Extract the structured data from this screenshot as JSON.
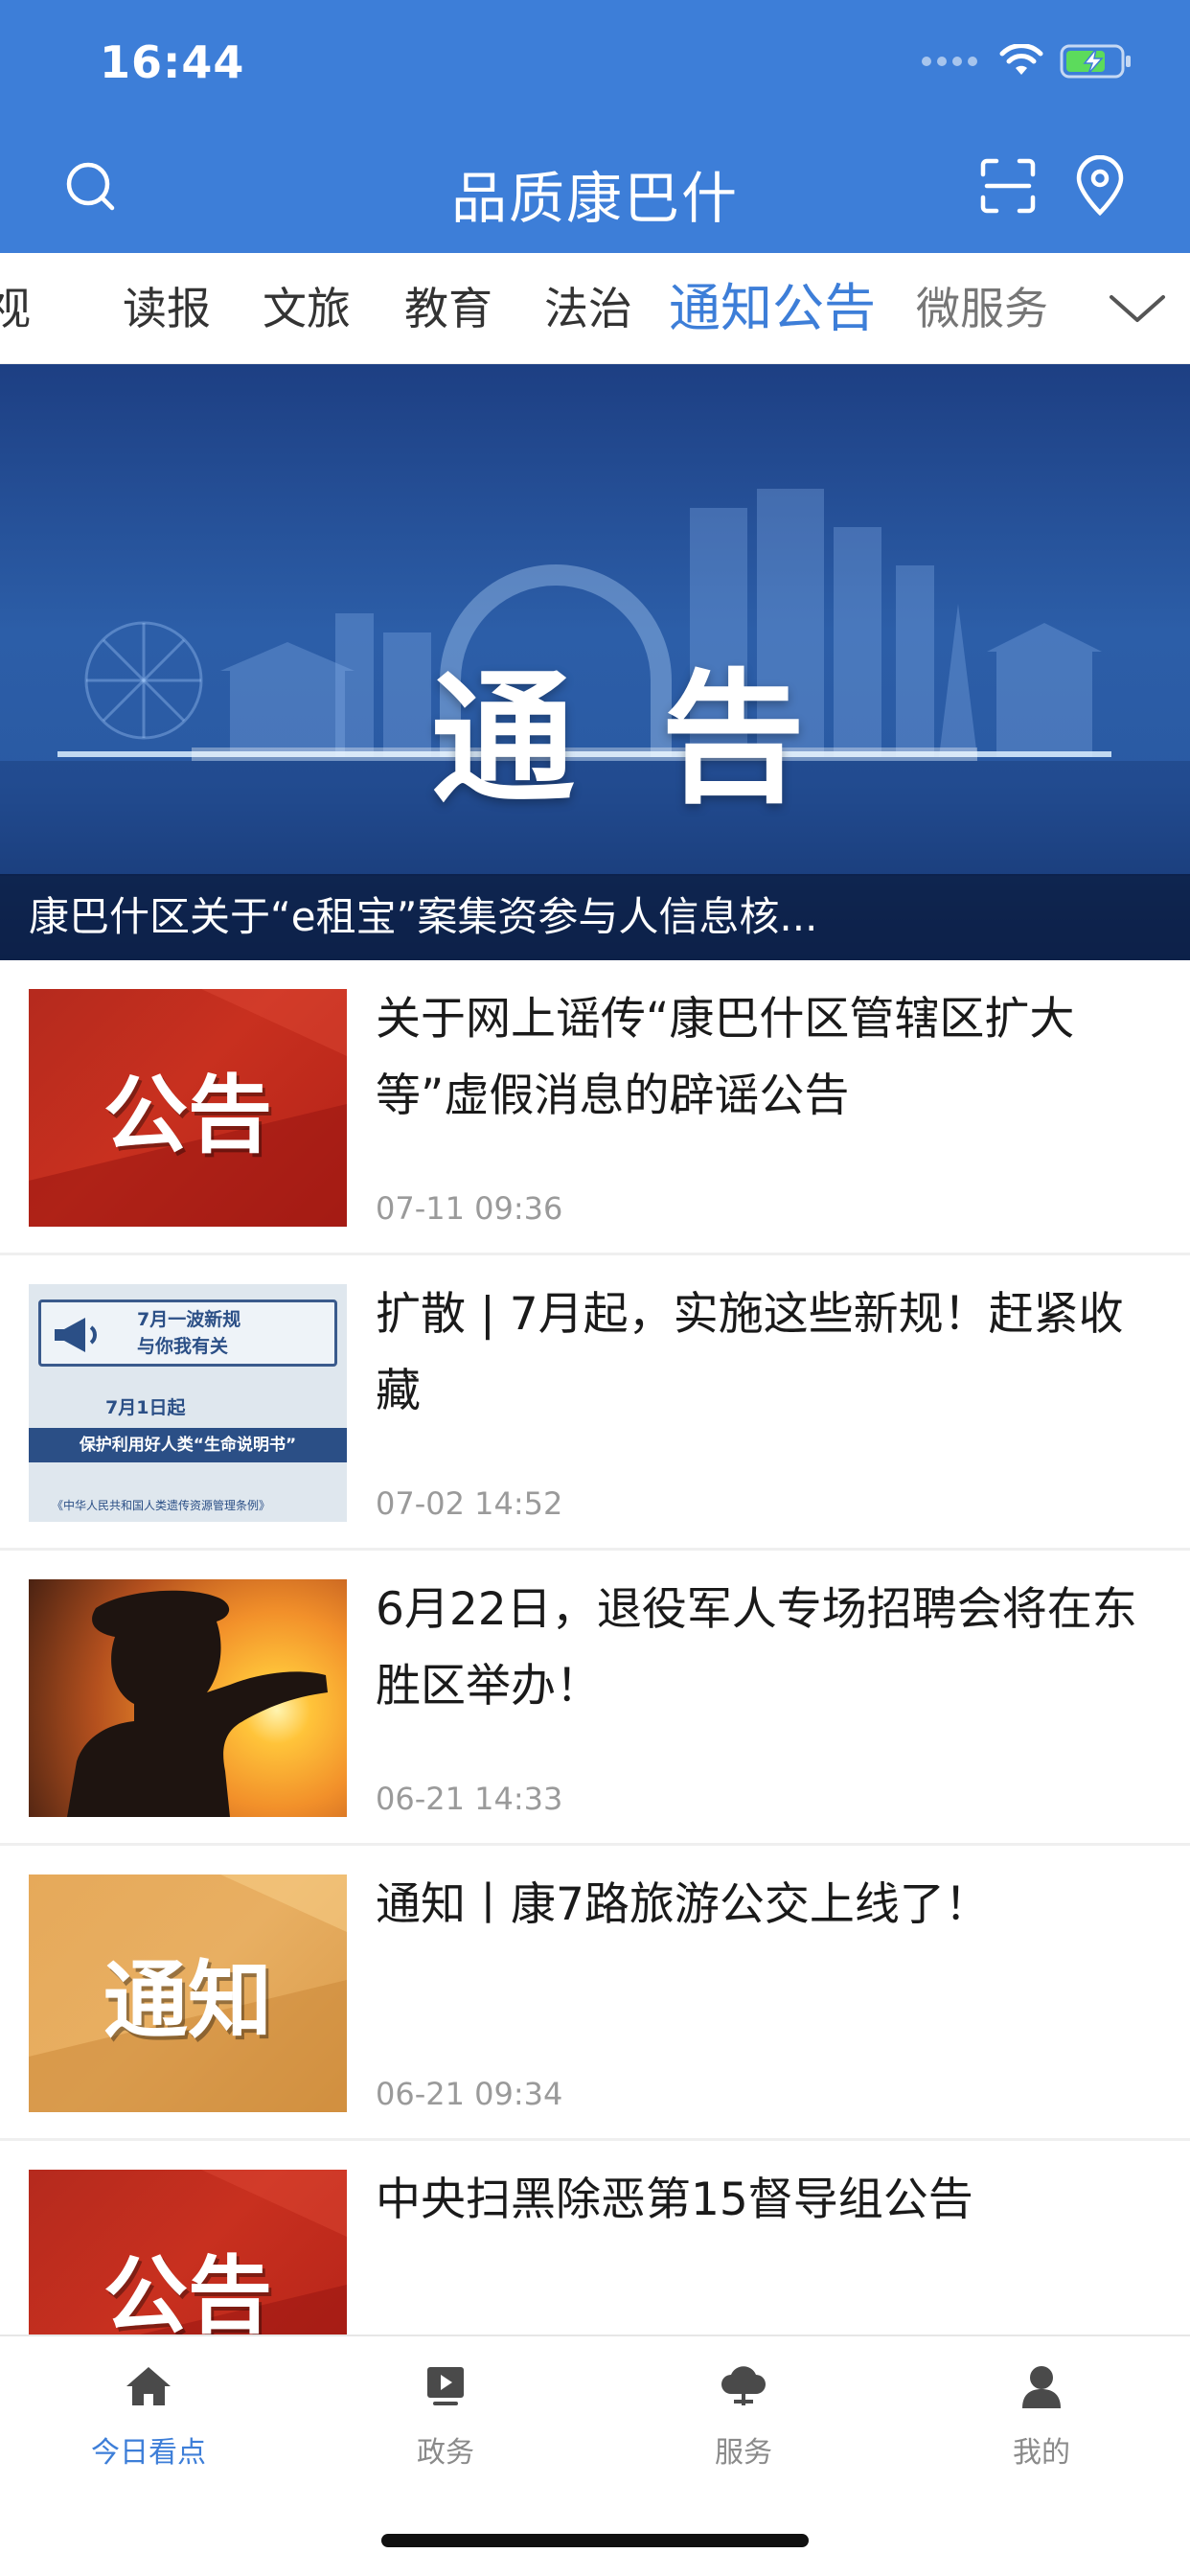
{
  "status_bar": {
    "time": "16:44"
  },
  "header": {
    "title": "品质康巴什",
    "icons": [
      "search-icon",
      "scan-icon",
      "location-pin-icon"
    ]
  },
  "tabs": {
    "items": [
      "视",
      "读报",
      "文旅",
      "教育",
      "法治",
      "通知公告",
      "微服务"
    ],
    "active": "通知公告",
    "more_icon": "chevron-down-icon"
  },
  "banner": {
    "image_text_left": "通",
    "image_text_right": "告",
    "caption": "康巴什区关于“e租宝”案集资参与人信息核..."
  },
  "news": [
    {
      "title": "关于网上谣传“康巴什区管辖区扩大等”虚假消息的辟谣公告",
      "time": "07-11 09:36",
      "thumb_text": "公告"
    },
    {
      "title": "扩散 | 7月起，实施这些新规！赶紧收藏",
      "time": "07-02 14:52",
      "thumb_lines": [
        "7月一波新规",
        "与你我有关",
        "7月1日起",
        "保护利用好人类“生命说明书”",
        "《中华人民共和国人类遗传资源管理条例》"
      ]
    },
    {
      "title": "6月22日，退役军人专场招聘会将在东胜区举办！",
      "time": "06-21 14:33"
    },
    {
      "title": "通知丨康7路旅游公交上线了！",
      "time": "06-21 09:34",
      "thumb_text": "通知"
    },
    {
      "title": "中央扫黑除恶第15督导组公告",
      "time": "",
      "thumb_text": "公告"
    }
  ],
  "bottom_nav": {
    "items": [
      {
        "label": "今日看点",
        "icon": "home-icon",
        "active": true
      },
      {
        "label": "政务",
        "icon": "video-play-icon",
        "active": false
      },
      {
        "label": "服务",
        "icon": "cloud-service-icon",
        "active": false
      },
      {
        "label": "我的",
        "icon": "user-icon",
        "active": false
      }
    ]
  },
  "colors": {
    "brand_blue": "#3d7ed8",
    "text_dark": "#1a1a1a",
    "text_gray": "#9a9a9a"
  }
}
